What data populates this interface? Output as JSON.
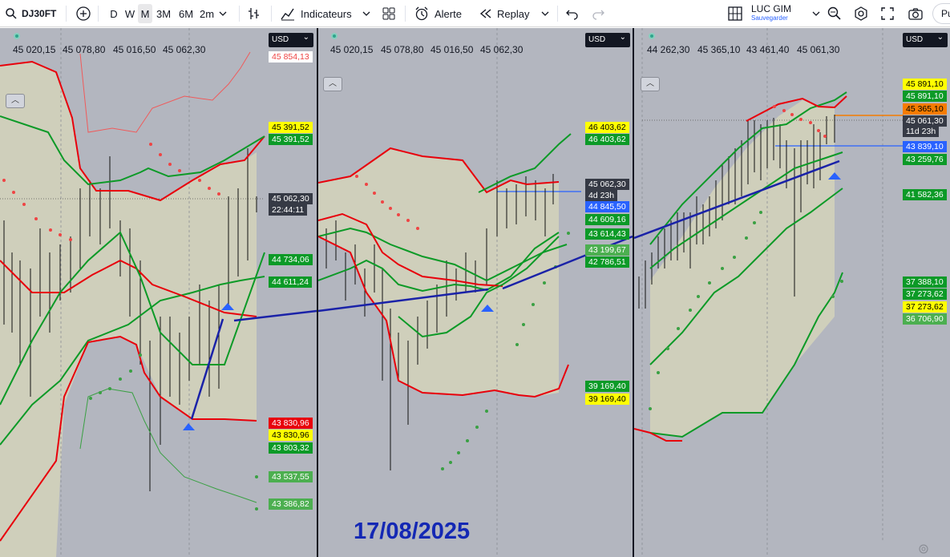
{
  "toolbar": {
    "symbol": "DJ30FT",
    "intervals": [
      "D",
      "W",
      "M",
      "3M",
      "6M",
      "2m"
    ],
    "indicators": "Indicateurs",
    "alert": "Alerte",
    "replay": "Replay",
    "user": "LUC GIM",
    "save": "Sauvegarder",
    "publish": "Pu"
  },
  "colors": {
    "bg": "#b3b6bf",
    "band": "#cfcfbb",
    "red": "#e8000b",
    "green": "#0c9a27",
    "blue": "#1a22a8"
  },
  "annotation": "17/08/2025",
  "panes": [
    {
      "currency": "USD",
      "x_labels": [
        "45 020,15",
        "45 078,80",
        "45 016,50",
        "45 062,30"
      ],
      "price_labels": [
        {
          "text": "45 854,13",
          "bg": "#ffffff",
          "fg": "#ef4444"
        },
        {
          "text": "45 391,52",
          "bg": "#ffff00",
          "fg": "#000000"
        },
        {
          "text": "45 391,52",
          "bg": "#0c9a27",
          "fg": "#ffffff"
        },
        {
          "text": "45 062,30",
          "bg": "#363a45",
          "fg": "#ffffff"
        },
        {
          "text": "22:44:11",
          "bg": "#363a45",
          "fg": "#ffffff"
        },
        {
          "text": "44 734,06",
          "bg": "#0c9a27",
          "fg": "#ffffff"
        },
        {
          "text": "44 611,24",
          "bg": "#0c9a27",
          "fg": "#ffffff"
        },
        {
          "text": "43 830,96",
          "bg": "#e8000b",
          "fg": "#ffffff"
        },
        {
          "text": "43 830,96",
          "bg": "#ffff00",
          "fg": "#000000"
        },
        {
          "text": "43 803,32",
          "bg": "#0c9a27",
          "fg": "#ffffff"
        },
        {
          "text": "43 537,55",
          "bg": "#4caf50",
          "fg": "#ffffff"
        },
        {
          "text": "43 386,82",
          "bg": "#4caf50",
          "fg": "#ffffff"
        }
      ]
    },
    {
      "currency": "USD",
      "x_labels": [
        "45 020,15",
        "45 078,80",
        "45 016,50",
        "45 062,30"
      ],
      "price_labels": [
        {
          "text": "46 403,62",
          "bg": "#ffff00",
          "fg": "#000000"
        },
        {
          "text": "46 403,62",
          "bg": "#0c9a27",
          "fg": "#ffffff"
        },
        {
          "text": "45 062,30",
          "bg": "#363a45",
          "fg": "#ffffff"
        },
        {
          "text": "4d 23h",
          "bg": "#363a45",
          "fg": "#ffffff"
        },
        {
          "text": "44 845,50",
          "bg": "#2962ff",
          "fg": "#ffffff"
        },
        {
          "text": "44 609,16",
          "bg": "#0c9a27",
          "fg": "#ffffff"
        },
        {
          "text": "43 614,43",
          "bg": "#0c9a27",
          "fg": "#ffffff"
        },
        {
          "text": "43 199,67",
          "bg": "#4caf50",
          "fg": "#ffffff"
        },
        {
          "text": "42 786,51",
          "bg": "#0c9a27",
          "fg": "#ffffff"
        },
        {
          "text": "39 169,40",
          "bg": "#0c9a27",
          "fg": "#ffffff"
        },
        {
          "text": "39 169,40",
          "bg": "#ffff00",
          "fg": "#000000"
        }
      ]
    },
    {
      "currency": "USD",
      "x_labels": [
        "44 262,30",
        "45 365,10",
        "43 461,40",
        "45 061,30"
      ],
      "price_labels": [
        {
          "text": "45 891,10",
          "bg": "#ffff00",
          "fg": "#000000"
        },
        {
          "text": "45 891,10",
          "bg": "#0c9a27",
          "fg": "#ffffff"
        },
        {
          "text": "45 365,10",
          "bg": "#f57c00",
          "fg": "#000000"
        },
        {
          "text": "45 061,30",
          "bg": "#363a45",
          "fg": "#ffffff"
        },
        {
          "text": "11d 23h",
          "bg": "#363a45",
          "fg": "#ffffff"
        },
        {
          "text": "43 839,10",
          "bg": "#2962ff",
          "fg": "#ffffff"
        },
        {
          "text": "43 259,76",
          "bg": "#0c9a27",
          "fg": "#ffffff"
        },
        {
          "text": "41 582,36",
          "bg": "#0c9a27",
          "fg": "#ffffff"
        },
        {
          "text": "37 388,10",
          "bg": "#0c9a27",
          "fg": "#ffffff"
        },
        {
          "text": "37 273,62",
          "bg": "#0c9a27",
          "fg": "#ffffff"
        },
        {
          "text": "37 273,62",
          "bg": "#ffff00",
          "fg": "#000000"
        },
        {
          "text": "36 706,90",
          "bg": "#4caf50",
          "fg": "#ffffff"
        }
      ]
    }
  ]
}
